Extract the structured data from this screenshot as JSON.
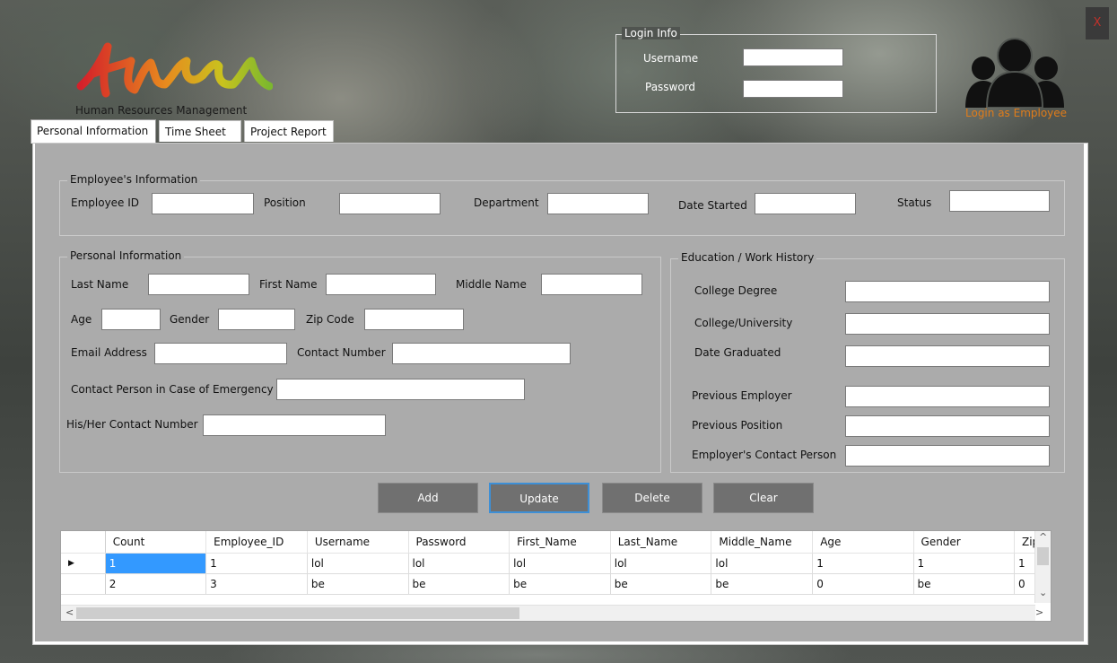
{
  "window": {
    "close_label": "X"
  },
  "logo": {
    "subtitle": "Human Resources Management"
  },
  "login": {
    "legend": "Login Info",
    "username_label": "Username",
    "password_label": "Password",
    "username_value": "",
    "password_value": ""
  },
  "employee_login": {
    "label": "Login as Employee"
  },
  "tabs": [
    {
      "label": "Personal Information"
    },
    {
      "label": "Time Sheet"
    },
    {
      "label": "Project Report"
    }
  ],
  "employee_info": {
    "legend": "Employee's Information",
    "employee_id_label": "Employee ID",
    "position_label": "Position",
    "department_label": "Department",
    "date_started_label": "Date Started",
    "status_label": "Status"
  },
  "personal_info": {
    "legend": "Personal Information",
    "last_name_label": "Last Name",
    "first_name_label": "First Name",
    "middle_name_label": "Middle Name",
    "age_label": "Age",
    "gender_label": "Gender",
    "zip_label": "Zip  Code",
    "email_label": "Email Address",
    "contact_number_label": "Contact Number",
    "emergency_contact_label": "Contact Person in Case of Emergency",
    "emergency_number_label": "His/Her Contact Number"
  },
  "education": {
    "legend": "Education / Work History",
    "college_degree_label": "College Degree",
    "college_label": "College/University",
    "date_graduated_label": "Date Graduated",
    "previous_employer_label": "Previous Employer",
    "previous_position_label": "Previous Position",
    "employer_contact_label": "Employer's Contact Person"
  },
  "buttons": {
    "add": "Add",
    "update": "Update",
    "delete": "Delete",
    "clear": "Clear"
  },
  "grid": {
    "columns": [
      "Count",
      "Employee_ID",
      "Username",
      "Password",
      "First_Name",
      "Last_Name",
      "Middle_Name",
      "Age",
      "Gender",
      "Zip_"
    ],
    "rows": [
      [
        "1",
        "1",
        "lol",
        "lol",
        "lol",
        "lol",
        "lol",
        "1",
        "1",
        "1"
      ],
      [
        "2",
        "3",
        "be",
        "be",
        "be",
        "be",
        "be",
        "0",
        "be",
        "0"
      ]
    ],
    "current_row_marker": "▶",
    "scroll_up": "^",
    "scroll_down": "⌄",
    "scroll_left": "<",
    "scroll_right": ">"
  }
}
